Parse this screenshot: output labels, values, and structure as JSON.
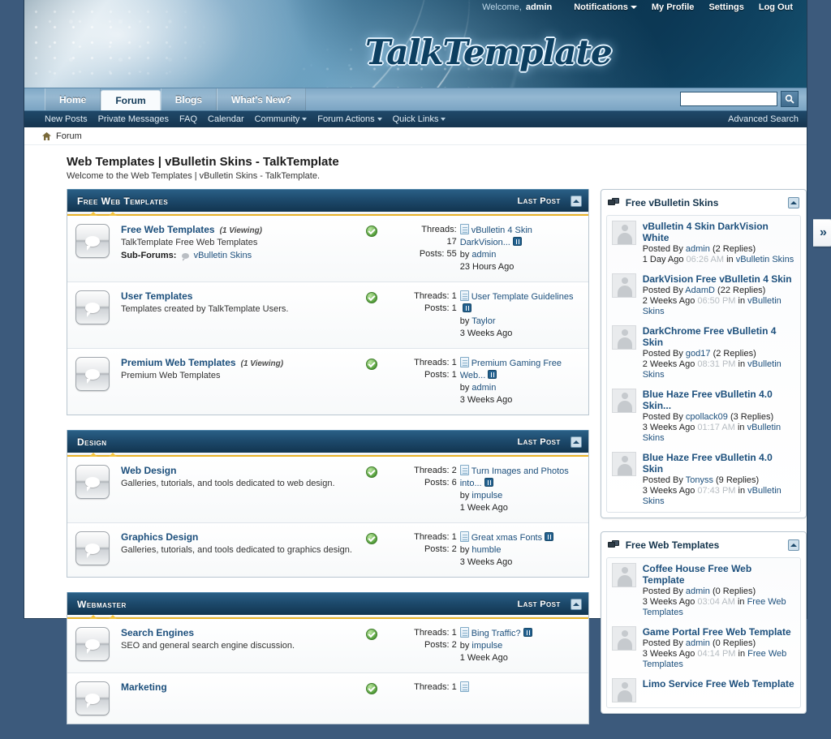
{
  "colors": {
    "page_bg": "#3c5a7c",
    "cat_header_dark": "#12354f",
    "accent_gold": "#e8b227",
    "link_blue": "#1c4f7c"
  },
  "header": {
    "logo_text": "TalkTemplate",
    "welcome_label": "Welcome,",
    "user": "admin",
    "links": [
      {
        "label": "Notifications",
        "caret": true
      },
      {
        "label": "My Profile",
        "caret": false
      },
      {
        "label": "Settings",
        "caret": false
      },
      {
        "label": "Log Out",
        "caret": false
      }
    ]
  },
  "nav": {
    "tabs": [
      {
        "label": "Home",
        "active": false
      },
      {
        "label": "Forum",
        "active": true
      },
      {
        "label": "Blogs",
        "active": false
      },
      {
        "label": "What's New?",
        "active": false
      }
    ],
    "search": {
      "value": "",
      "placeholder": "",
      "icon": "search-icon"
    },
    "subnav": [
      {
        "label": "New Posts",
        "caret": false
      },
      {
        "label": "Private Messages",
        "caret": false
      },
      {
        "label": "FAQ",
        "caret": false
      },
      {
        "label": "Calendar",
        "caret": false
      },
      {
        "label": "Community",
        "caret": true
      },
      {
        "label": "Forum Actions",
        "caret": true
      },
      {
        "label": "Quick Links",
        "caret": true
      }
    ],
    "advanced_search": "Advanced Search"
  },
  "breadcrumb": {
    "home_icon": "home-icon",
    "items": [
      "Forum"
    ]
  },
  "page": {
    "title": "Web Templates | vBulletin Skins - TalkTemplate",
    "subtitle": "Welcome to the Web Templates | vBulletin Skins - TalkTemplate."
  },
  "categories": [
    {
      "title": "Free Web Templates",
      "last_post_header": "Last Post",
      "forums": [
        {
          "name": "Free Web Templates",
          "viewing": "(1 Viewing)",
          "desc": "TalkTemplate Free Web Templates",
          "subforums_label": "Sub-Forums:",
          "subforums": [
            "vBulletin Skins"
          ],
          "threads_label": "Threads:",
          "threads": "17",
          "posts_label": "Posts:",
          "posts": "55",
          "last_title": "vBulletin 4 Skin DarkVision...",
          "last_multipage": true,
          "last_by_label": "by",
          "last_by": "admin",
          "last_time": "23 Hours Ago",
          "stats_stacked": true
        },
        {
          "name": "User Templates",
          "viewing": "",
          "desc": "Templates created by TalkTemplate Users.",
          "subforums_label": "",
          "subforums": [],
          "threads_label": "Threads:",
          "threads": "1",
          "posts_label": "Posts:",
          "posts": "1",
          "last_title": "User Template Guidelines",
          "last_multipage": true,
          "last_by_label": "by",
          "last_by": "Taylor",
          "last_time": "3 Weeks Ago",
          "stats_stacked": false
        },
        {
          "name": "Premium Web Templates",
          "viewing": "(1 Viewing)",
          "desc": "Premium Web Templates",
          "subforums_label": "",
          "subforums": [],
          "threads_label": "Threads:",
          "threads": "1",
          "posts_label": "Posts:",
          "posts": "1",
          "last_title": "Premium Gaming Free Web...",
          "last_multipage": true,
          "last_by_label": "by",
          "last_by": "admin",
          "last_time": "3 Weeks Ago",
          "stats_stacked": false
        }
      ]
    },
    {
      "title": "Design",
      "last_post_header": "Last Post",
      "forums": [
        {
          "name": "Web Design",
          "viewing": "",
          "desc": "Galleries, tutorials, and tools dedicated to web design.",
          "subforums_label": "",
          "subforums": [],
          "threads_label": "Threads:",
          "threads": "2",
          "posts_label": "Posts:",
          "posts": "6",
          "last_title": "Turn Images and Photos into...",
          "last_multipage": true,
          "last_by_label": "by",
          "last_by": "impulse",
          "last_time": "1 Week Ago",
          "stats_stacked": false
        },
        {
          "name": "Graphics Design",
          "viewing": "",
          "desc": "Galleries, tutorials, and tools dedicated to graphics design.",
          "subforums_label": "",
          "subforums": [],
          "threads_label": "Threads:",
          "threads": "1",
          "posts_label": "Posts:",
          "posts": "2",
          "last_title": "Great xmas Fonts",
          "last_multipage": true,
          "last_by_label": "by",
          "last_by": "humble",
          "last_time": "3 Weeks Ago",
          "stats_stacked": false
        }
      ]
    },
    {
      "title": "Webmaster",
      "last_post_header": "Last Post",
      "forums": [
        {
          "name": "Search Engines",
          "viewing": "",
          "desc": "SEO and general search engine discussion.",
          "subforums_label": "",
          "subforums": [],
          "threads_label": "Threads:",
          "threads": "1",
          "posts_label": "Posts:",
          "posts": "2",
          "last_title": "Bing Traffic?",
          "last_multipage": true,
          "last_by_label": "by",
          "last_by": "impulse",
          "last_time": "1 Week Ago",
          "stats_stacked": false
        },
        {
          "name": "Marketing",
          "viewing": "",
          "desc": "",
          "subforums_label": "",
          "subforums": [],
          "threads_label": "Threads:",
          "threads": "1",
          "posts_label": "",
          "posts": "",
          "last_title": "",
          "last_multipage": false,
          "last_by_label": "",
          "last_by": "",
          "last_time": "",
          "stats_stacked": false
        }
      ]
    }
  ],
  "sidebar": {
    "pulltab_icon": "chevron-double-right-icon",
    "widgets": [
      {
        "title": "Free vBulletin Skins",
        "icon": "forum-bubbles-icon",
        "items": [
          {
            "title": "vBulletin 4 Skin DarkVision White",
            "posted_by_label": "Posted By",
            "author": "admin",
            "replies": "(2 Replies)",
            "ago": "1 Day Ago",
            "clock": "06:26 AM",
            "in_label": "in",
            "forum": "vBulletin Skins"
          },
          {
            "title": "DarkVision Free vBulletin 4 Skin",
            "posted_by_label": "Posted By",
            "author": "AdamD",
            "replies": "(22 Replies)",
            "ago": "2 Weeks Ago",
            "clock": "06:50 PM",
            "in_label": "in",
            "forum": "vBulletin Skins"
          },
          {
            "title": "DarkChrome Free vBulletin 4 Skin",
            "posted_by_label": "Posted By",
            "author": "god17",
            "replies": "(2 Replies)",
            "ago": "2 Weeks Ago",
            "clock": "08:31 PM",
            "in_label": "in",
            "forum": "vBulletin Skins"
          },
          {
            "title": "Blue Haze Free vBulletin 4.0 Skin...",
            "posted_by_label": "Posted By",
            "author": "cpollack09",
            "replies": "(3 Replies)",
            "ago": "3 Weeks Ago",
            "clock": "01:17 AM",
            "in_label": "in",
            "forum": "vBulletin Skins"
          },
          {
            "title": "Blue Haze Free vBulletin 4.0 Skin",
            "posted_by_label": "Posted By",
            "author": "Tonyss",
            "replies": "(9 Replies)",
            "ago": "3 Weeks Ago",
            "clock": "07:43 PM",
            "in_label": "in",
            "forum": "vBulletin Skins"
          }
        ]
      },
      {
        "title": "Free Web Templates",
        "icon": "forum-bubbles-icon",
        "items": [
          {
            "title": "Coffee House Free Web Template",
            "posted_by_label": "Posted By",
            "author": "admin",
            "replies": "(0 Replies)",
            "ago": "3 Weeks Ago",
            "clock": "03:04 AM",
            "in_label": "in",
            "forum": "Free Web Templates"
          },
          {
            "title": "Game Portal Free Web Template",
            "posted_by_label": "Posted By",
            "author": "admin",
            "replies": "(0 Replies)",
            "ago": "3 Weeks Ago",
            "clock": "04:14 PM",
            "in_label": "in",
            "forum": "Free Web Templates"
          },
          {
            "title": "Limo Service Free Web Template",
            "posted_by_label": "",
            "author": "",
            "replies": "",
            "ago": "",
            "clock": "",
            "in_label": "",
            "forum": ""
          }
        ]
      }
    ]
  }
}
